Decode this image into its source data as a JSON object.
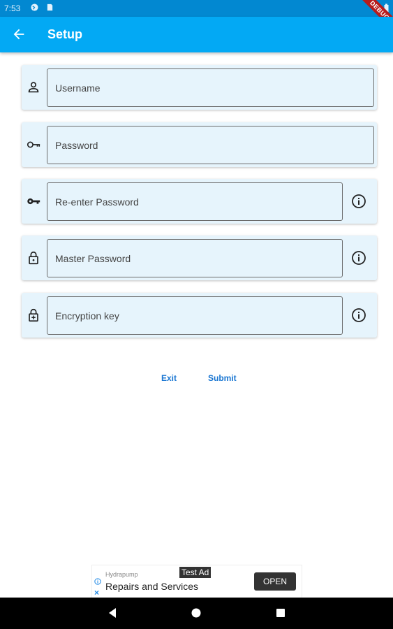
{
  "status_bar": {
    "time": "7:53"
  },
  "debug_banner": "DEBUG",
  "app_bar": {
    "title": "Setup"
  },
  "fields": [
    {
      "name": "username",
      "placeholder": "Username",
      "icon": "person-icon",
      "info": false
    },
    {
      "name": "password",
      "placeholder": "Password",
      "icon": "key-outline-icon",
      "info": false
    },
    {
      "name": "reenter-password",
      "placeholder": "Re-enter Password",
      "icon": "key-icon",
      "info": true
    },
    {
      "name": "master-password",
      "placeholder": "Master Password",
      "icon": "lock-icon",
      "info": true
    },
    {
      "name": "encryption-key",
      "placeholder": "Encryption key",
      "icon": "lock-alert-icon",
      "info": true
    }
  ],
  "actions": {
    "exit_label": "Exit",
    "submit_label": "Submit"
  },
  "ad": {
    "label": "Test Ad",
    "brand": "Hydrapump",
    "headline": "Repairs and Services",
    "open_label": "OPEN",
    "close_glyph": "×"
  },
  "colors": {
    "app_bar": "#03a9f4",
    "status_bar": "#0288d1",
    "field_bg": "#e6f4fc",
    "action_text": "#1976d2"
  }
}
